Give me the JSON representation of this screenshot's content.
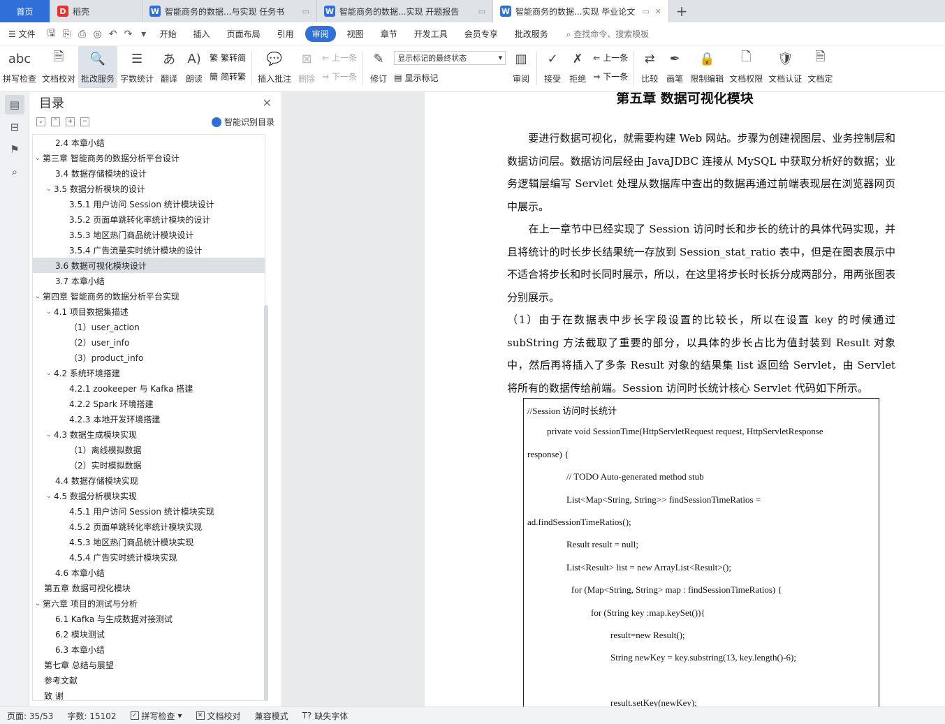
{
  "tabs": {
    "home": "首页",
    "daoke": "稻壳",
    "doc1": "智能商务的数据...与实现 任务书",
    "doc2": "智能商务的数据...实现 开题报告",
    "doc3": "智能商务的数据...实现 毕业论文",
    "new_tab": "+"
  },
  "menu": {
    "file": "文件",
    "items": [
      "开始",
      "插入",
      "页面布局",
      "引用",
      "审阅",
      "视图",
      "章节",
      "开发工具",
      "会员专享",
      "批改服务"
    ],
    "active": "审阅",
    "search": "查找命令、搜索模板"
  },
  "ribbon": {
    "spell": "拼写检查",
    "proofread": "文档校对",
    "review_service": "批改服务",
    "word_count": "字数统计",
    "translate": "翻译",
    "read_aloud": "朗读",
    "to_traditional": "繁转简",
    "to_simplified": "简转繁",
    "insert_comment": "插入批注",
    "delete": "删除",
    "prev1": "上一条",
    "next1": "下一条",
    "revise": "修订",
    "markup_select": "显示标记的最终状态",
    "show_markup": "显示标记",
    "review": "审阅",
    "accept": "接受",
    "reject": "拒绝",
    "prev2": "上一条",
    "next2": "下一条",
    "compare": "比较",
    "pen": "画笔",
    "restrict": "限制编辑",
    "permission": "文档权限",
    "certify": "文档认证",
    "last": "文档定"
  },
  "toc": {
    "title": "目录",
    "smart": "智能识别目录",
    "items": [
      {
        "text": "2.4  本章小结",
        "level": 2,
        "caret": ""
      },
      {
        "text": "第三章  智能商务的数据分析平台设计",
        "level": 1,
        "caret": "v"
      },
      {
        "text": "3.4 数据存储模块的设计",
        "level": 2,
        "caret": ""
      },
      {
        "text": "3.5 数据分析模块的设计",
        "level": 2,
        "caret": "v"
      },
      {
        "text": "3.5.1  用户访问 Session 统计模块设计",
        "level": 3,
        "caret": ""
      },
      {
        "text": "3.5.2  页面单跳转化率统计模块的设计",
        "level": 3,
        "caret": ""
      },
      {
        "text": "3.5.3  地区热门商品统计模块设计",
        "level": 3,
        "caret": ""
      },
      {
        "text": "3.5.4 广告流量实时统计模块的设计",
        "level": 3,
        "caret": ""
      },
      {
        "text": "3.6 数据可视化模块设计",
        "level": 2,
        "caret": "",
        "selected": true
      },
      {
        "text": "3.7  本章小结",
        "level": 2,
        "caret": ""
      },
      {
        "text": "第四章  智能商务的数据分析平台实现",
        "level": 1,
        "caret": "v"
      },
      {
        "text": "4.1 项目数据集描述",
        "level": 2,
        "caret": "v"
      },
      {
        "text": "（1）user_action",
        "level": 3,
        "caret": ""
      },
      {
        "text": "（2）user_info",
        "level": 3,
        "caret": ""
      },
      {
        "text": "（3）product_info",
        "level": 3,
        "caret": ""
      },
      {
        "text": "4.2 系统环境搭建",
        "level": 2,
        "caret": "v"
      },
      {
        "text": "4.2.1 zookeeper 与 Kafka 搭建",
        "level": 3,
        "caret": ""
      },
      {
        "text": "4.2.2 Spark 环境搭建",
        "level": 3,
        "caret": ""
      },
      {
        "text": "4.2.3 本地开发环境搭建",
        "level": 3,
        "caret": ""
      },
      {
        "text": "4.3 数据生成模块实现",
        "level": 2,
        "caret": "v"
      },
      {
        "text": "（1）离线模拟数据",
        "level": 3,
        "caret": ""
      },
      {
        "text": "（2）实时模拟数据",
        "level": 3,
        "caret": ""
      },
      {
        "text": "4.4 数据存储模块实现",
        "level": 2,
        "caret": ""
      },
      {
        "text": "4.5 数据分析模块实现",
        "level": 2,
        "caret": "v"
      },
      {
        "text": "4.5.1 用户访问 Session 统计模块实现",
        "level": 3,
        "caret": ""
      },
      {
        "text": "4.5.2 页面单跳转化率统计模块实现",
        "level": 3,
        "caret": ""
      },
      {
        "text": "4.5.3 地区热门商品统计模块实现",
        "level": 3,
        "caret": ""
      },
      {
        "text": "4.5.4 广告实时统计模块实现",
        "level": 3,
        "caret": ""
      },
      {
        "text": "4.6  本章小结",
        "level": 2,
        "caret": ""
      },
      {
        "text": "第五章  数据可视化模块",
        "level": 1,
        "caret": ""
      },
      {
        "text": "第六章  项目的测试与分析",
        "level": 1,
        "caret": "v"
      },
      {
        "text": "6.1 Kafka 与生成数据对接测试",
        "level": 2,
        "caret": ""
      },
      {
        "text": "6.2 模块测试",
        "level": 2,
        "caret": ""
      },
      {
        "text": "6.3 本章小结",
        "level": 2,
        "caret": ""
      },
      {
        "text": "第七章  总结与展望",
        "level": 1,
        "caret": ""
      },
      {
        "text": "参考文献",
        "level": 1,
        "caret": ""
      },
      {
        "text": "致    谢",
        "level": 1,
        "caret": ""
      }
    ]
  },
  "doc": {
    "chapter": "第五章  数据可视化模块",
    "paragraphs": [
      "　　要进行数据可视化，就需要构建 Web 网站。步骤为创建视图层、业务控制层和数据访问层。数据访问层经由 JavaJDBC 连接从 MySQL 中获取分析好的数据；业务逻辑层编写 Servlet 处理从数据库中查出的数据再通过前端表现层在浏览器网页中展示。",
      "　　在上一章节中已经实现了 Session 访问时长和步长的统计的具体代码实现，并且将统计的时长步长结果统一存放到 Session_stat_ratio 表中，但是在图表展示中不适合将步长和时长同时展示，所以，在这里将步长时长拆分成两部分，用两张图表分别展示。",
      "（1）由于在数据表中步长字段设置的比较长，所以在设置 key 的时候通过 subString 方法截取了重要的部分，以具体的步长占比为值封装到 Result 对象中，然后再将插入了多条 Result 对象的结果集 list 返回给 Servlet，由 Servlet 将所有的数据传给前端。Session 访问时长统计核心 Servlet 代码如下所示。"
    ],
    "code": [
      "//Session 访问时长统计",
      "private void SessionTime(HttpServletRequest request, HttpServletResponse",
      "response) {",
      "// TODO Auto-generated method stub",
      "List<Map<String, String>> findSessionTimeRatios =",
      "ad.findSessionTimeRatios();",
      "Result result = null;",
      "List<Result> list = new ArrayList<Result>();",
      "for (Map<String, String> map : findSessionTimeRatios) {",
      "for (String key :map.keySet()){",
      "result=new Result();",
      "String newKey = key.substring(13, key.length()-6);",
      "result.setKey(newKey);"
    ]
  },
  "status": {
    "page": "页面: 35/53",
    "words": "字数: 15102",
    "spell": "拼写检查",
    "proof": "文档校对",
    "compat": "兼容模式",
    "missing_font": "缺失字体"
  }
}
